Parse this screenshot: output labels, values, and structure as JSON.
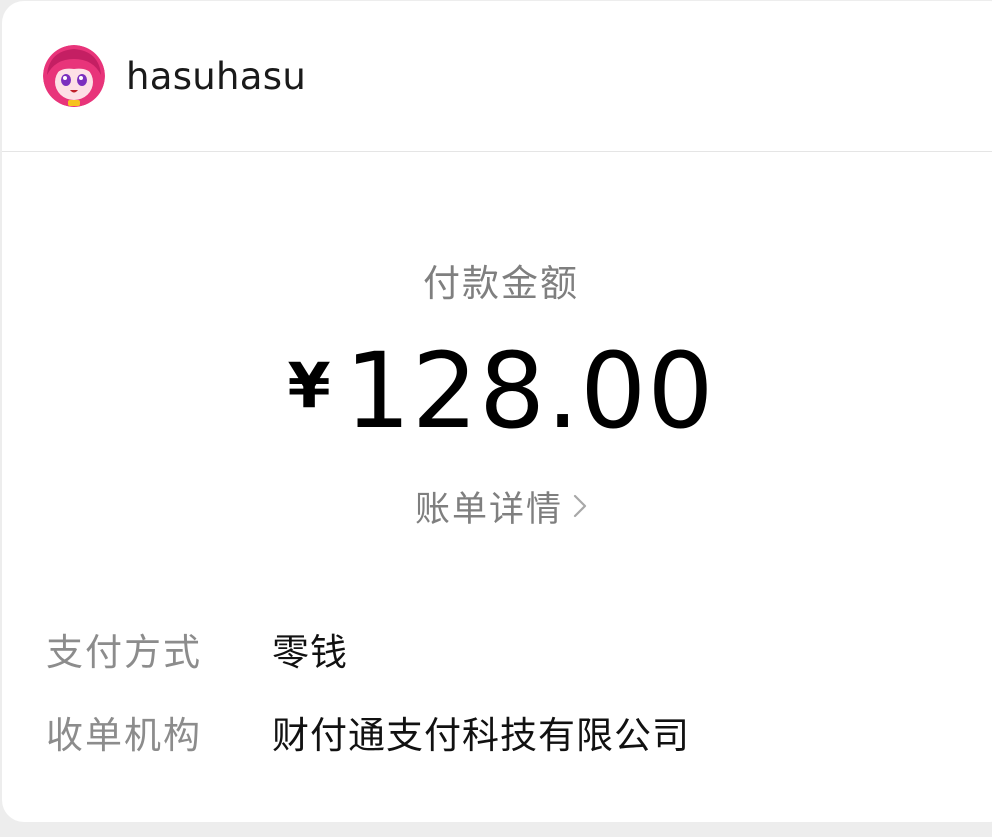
{
  "merchant": {
    "name": "hasuhasu",
    "avatar_icon": "anime-avatar-icon"
  },
  "payment": {
    "amount_label": "付款金额",
    "currency_symbol": "¥",
    "amount": "128.00",
    "details_link": "账单详情",
    "details_icon": "chevron-right-icon"
  },
  "info": [
    {
      "label": "支付方式",
      "value": "零钱"
    },
    {
      "label": "收单机构",
      "value": "财付通支付科技有限公司"
    }
  ],
  "colors": {
    "background": "#ededed",
    "card": "#ffffff",
    "label_gray": "#7f7f7f",
    "text_dark": "#111111",
    "divider": "#e5e5e5"
  }
}
